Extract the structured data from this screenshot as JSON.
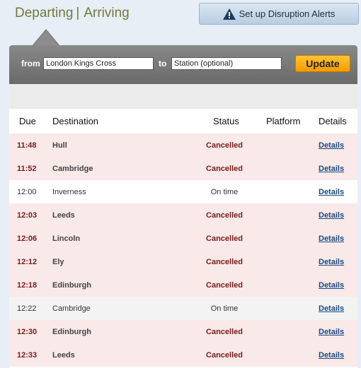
{
  "tabs": {
    "departing": "Departing",
    "separator": "|",
    "arriving": "Arriving"
  },
  "alert_button": {
    "label": "Set up Disruption Alerts"
  },
  "search": {
    "from_label": "from",
    "from_value": "London Kings Cross",
    "to_label": "to",
    "to_placeholder": "Station (optional)",
    "update_label": "Update"
  },
  "table": {
    "headers": {
      "due": "Due",
      "destination": "Destination",
      "status": "Status",
      "platform": "Platform",
      "details": "Details"
    },
    "rows": [
      {
        "due": "11:48",
        "destination": "Hull",
        "status": "Cancelled",
        "platform": "",
        "details": "Details"
      },
      {
        "due": "11:52",
        "destination": "Cambridge",
        "status": "Cancelled",
        "platform": "",
        "details": "Details"
      },
      {
        "due": "12:00",
        "destination": "Inverness",
        "status": "On time",
        "platform": "",
        "details": "Details"
      },
      {
        "due": "12:03",
        "destination": "Leeds",
        "status": "Cancelled",
        "platform": "",
        "details": "Details"
      },
      {
        "due": "12:06",
        "destination": "Lincoln",
        "status": "Cancelled",
        "platform": "",
        "details": "Details"
      },
      {
        "due": "12:12",
        "destination": "Ely",
        "status": "Cancelled",
        "platform": "",
        "details": "Details"
      },
      {
        "due": "12:18",
        "destination": "Edinburgh",
        "status": "Cancelled",
        "platform": "",
        "details": "Details"
      },
      {
        "due": "12:22",
        "destination": "Cambridge",
        "status": "On time",
        "platform": "",
        "details": "Details"
      },
      {
        "due": "12:30",
        "destination": "Edinburgh",
        "status": "Cancelled",
        "platform": "",
        "details": "Details"
      },
      {
        "due": "12:33",
        "destination": "Leeds",
        "status": "Cancelled",
        "platform": "",
        "details": "Details"
      }
    ]
  },
  "colors": {
    "cancelled_text": "#7a1a1a",
    "cancelled_row": "#f9e9e9",
    "update_button": "#f59b00",
    "link": "#1a4a80"
  },
  "icons": {
    "alert": "warning-triangle-icon"
  }
}
